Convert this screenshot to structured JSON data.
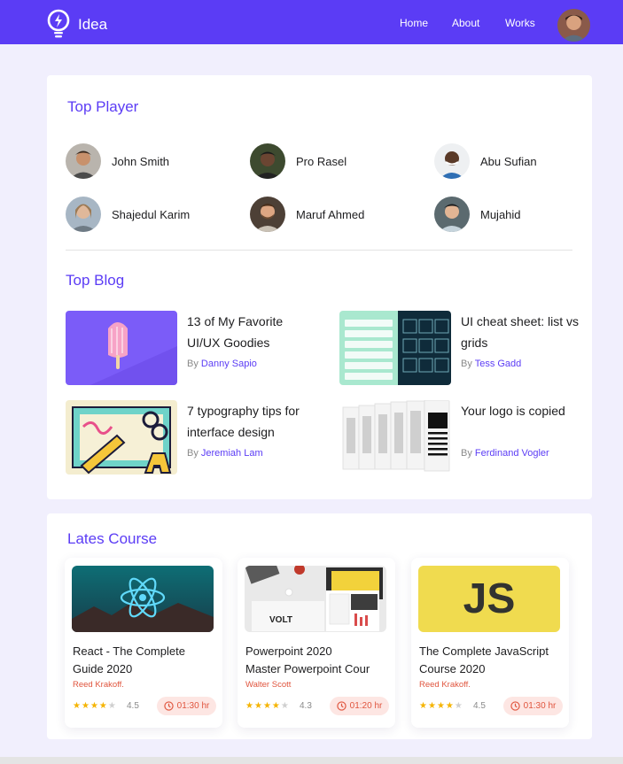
{
  "colors": {
    "brand": "#5b3cf5",
    "accent_red": "#e0553e",
    "star": "#f5b400",
    "page_bg": "#f1effd"
  },
  "brand": {
    "name": "Idea",
    "icon": "lightbulb-icon"
  },
  "nav": {
    "items": [
      "Home",
      "About",
      "Works"
    ],
    "avatar": "user-avatar"
  },
  "top_player": {
    "title": "Top Player",
    "players": [
      {
        "name": "John Smith"
      },
      {
        "name": "Pro Rasel"
      },
      {
        "name": "Abu Sufian"
      },
      {
        "name": "Shajedul Karim"
      },
      {
        "name": "Maruf Ahmed"
      },
      {
        "name": "Mujahid"
      }
    ]
  },
  "top_blog": {
    "title": "Top Blog",
    "by_label": "By",
    "posts": [
      {
        "title": "13 of My Favorite UI/UX Goodies",
        "author": "Danny Sapio"
      },
      {
        "title": "UI cheat sheet: list vs grids",
        "author": "Tess Gadd"
      },
      {
        "title": "7 typography tips for interface design",
        "author": "Jeremiah Lam"
      },
      {
        "title": "Your logo is copied",
        "author": "Ferdinand Vogler"
      }
    ]
  },
  "courses": {
    "title": "Lates Course",
    "items": [
      {
        "title_line1": "React - The Complete",
        "title_line2": "Guide 2020",
        "author": "Reed Krakoff.",
        "rating": "4.5",
        "stars": 4,
        "duration": "01:30 hr",
        "image_text": ""
      },
      {
        "title_line1": "Powerpoint 2020",
        "title_line2": "Master Powerpoint Cour",
        "author": "Walter Scott",
        "rating": "4.3",
        "stars": 4,
        "duration": "01:20 hr",
        "image_text": "VOLT"
      },
      {
        "title_line1": "The Complete JavaScript",
        "title_line2": "Course 2020",
        "author": "Reed Krakoff.",
        "rating": "4.5",
        "stars": 4,
        "duration": "01:30 hr",
        "image_text": "JS"
      }
    ]
  }
}
